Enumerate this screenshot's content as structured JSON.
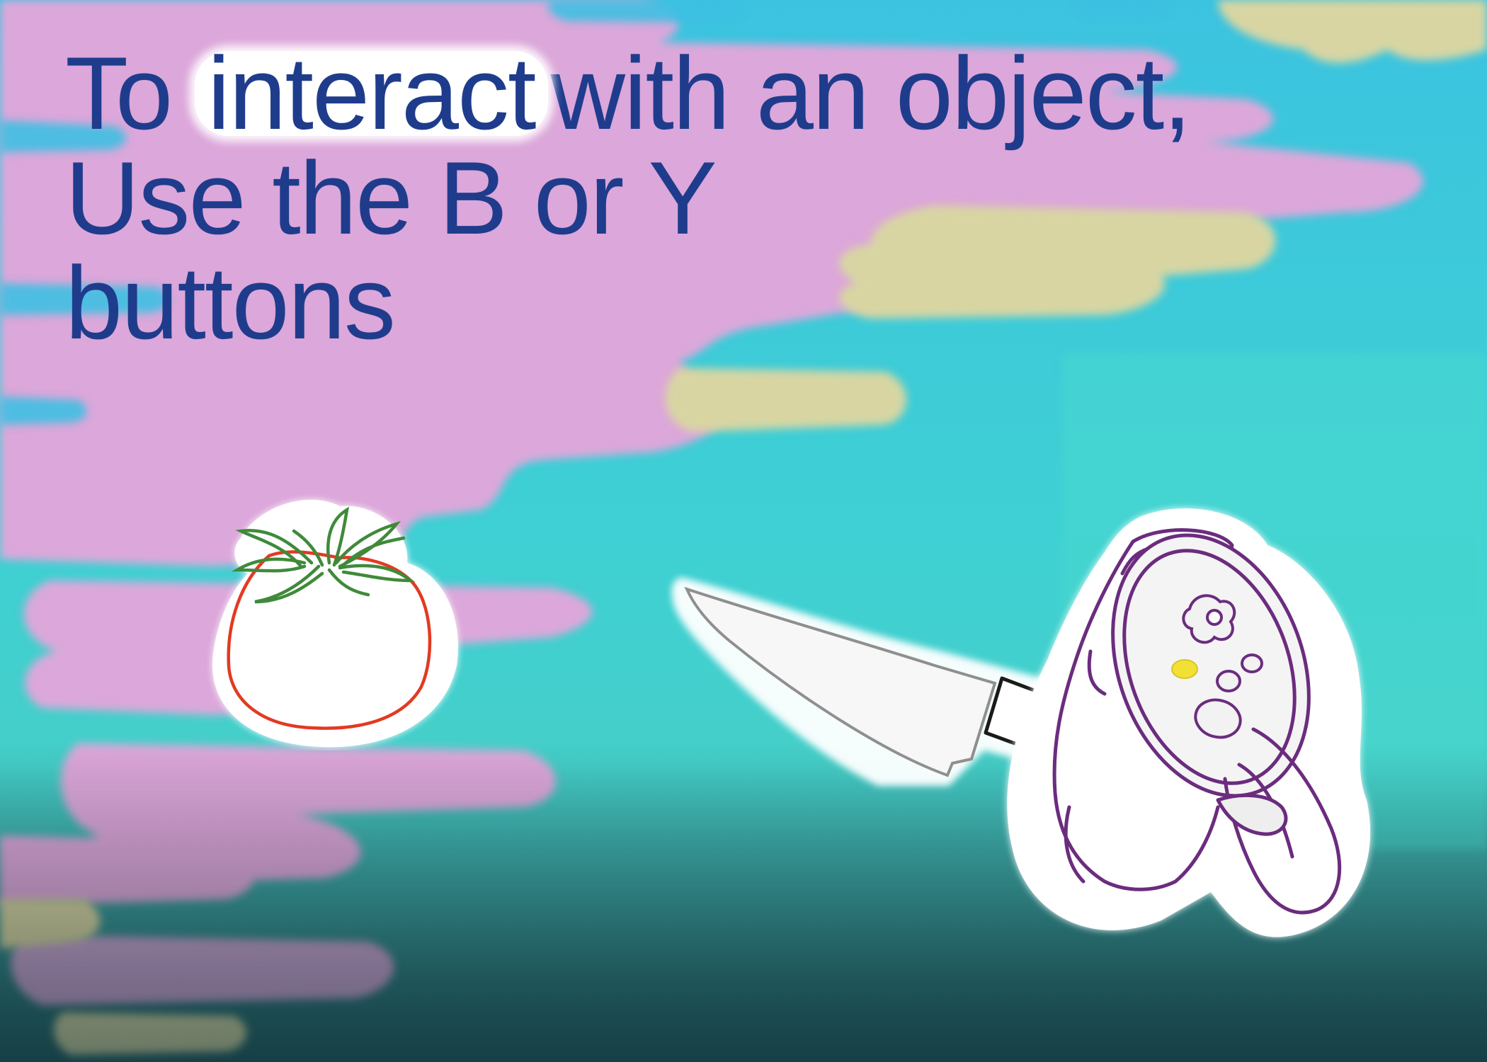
{
  "instruction": {
    "prefix": "To",
    "highlight": "interact",
    "suffix": "with an object,",
    "line2": "Use the B or Y",
    "line3": "buttons"
  },
  "colors": {
    "text": "#1f3c8c",
    "sky_pink": "#dca7da",
    "sky_yellow": "#d8d5a3",
    "sky_teal": "#3fd3cf",
    "sky_blue": "#3ec6e6",
    "tomato_outline": "#e23a22",
    "stem": "#3f8a3a",
    "controller_outline": "#6b2c7e",
    "button_yellow": "#f2e034"
  },
  "objects": {
    "tomato": "tomato-icon",
    "knife": "knife-icon",
    "controller": "vr-controller-icon"
  }
}
